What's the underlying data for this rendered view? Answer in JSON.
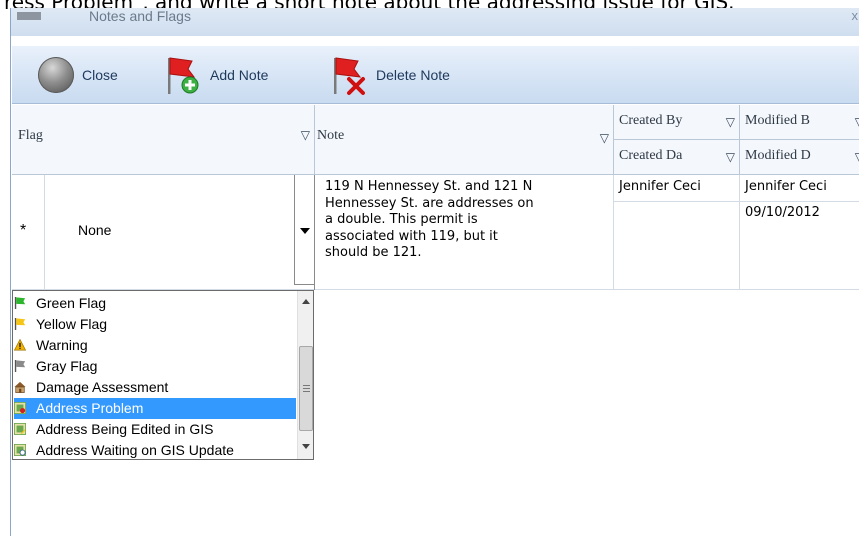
{
  "caption": "ress Problem\", and write a short note about the addressing issue for GIS.",
  "window": {
    "title": "Notes and Flags",
    "close_glyph": "x"
  },
  "toolbar": {
    "close_label": "Close",
    "add_label": "Add Note",
    "delete_label": "Delete Note",
    "icons": {
      "close": "gray-orb-icon",
      "add": "red-flag-add-icon",
      "delete": "red-flag-delete-icon"
    }
  },
  "grid": {
    "headers": {
      "flag": "Flag",
      "note": "Note",
      "created_by": "Created By",
      "modified_by": "Modified B",
      "created_date": "Created Da",
      "modified_date": "Modified D",
      "filter_glyph": "▽"
    },
    "row": {
      "row_marker": "*",
      "flag_value": "None",
      "note_lines": [
        "119 N Hennessey St. and 121 N",
        "Hennessey St. are addresses on",
        "a double. This permit is",
        "associated with 119, but it",
        "should be 121."
      ],
      "created_by": "Jennifer Ceci",
      "modified_by": "Jennifer Ceci",
      "created_date": "",
      "modified_date": "09/10/2012"
    }
  },
  "flag_dropdown": {
    "selected": "Address Problem",
    "options": [
      {
        "label": "Green Flag",
        "icon": "green-flag-icon",
        "color": "#2db52d"
      },
      {
        "label": "Yellow Flag",
        "icon": "yellow-flag-icon",
        "color": "#f5c518"
      },
      {
        "label": "Warning",
        "icon": "warning-icon",
        "color": "#f2b400"
      },
      {
        "label": "Gray Flag",
        "icon": "gray-flag-icon",
        "color": "#8a8a8a"
      },
      {
        "label": "Damage Assessment",
        "icon": "damaged-house-icon",
        "color": "#8b5a2b"
      },
      {
        "label": "Address Problem",
        "icon": "address-problem-icon",
        "color": "#6aa84f"
      },
      {
        "label": "Address Being Edited in GIS",
        "icon": "address-editing-icon",
        "color": "#6aa84f"
      },
      {
        "label": "Address Waiting on GIS Update",
        "icon": "address-waiting-icon",
        "color": "#6aa84f"
      }
    ]
  }
}
